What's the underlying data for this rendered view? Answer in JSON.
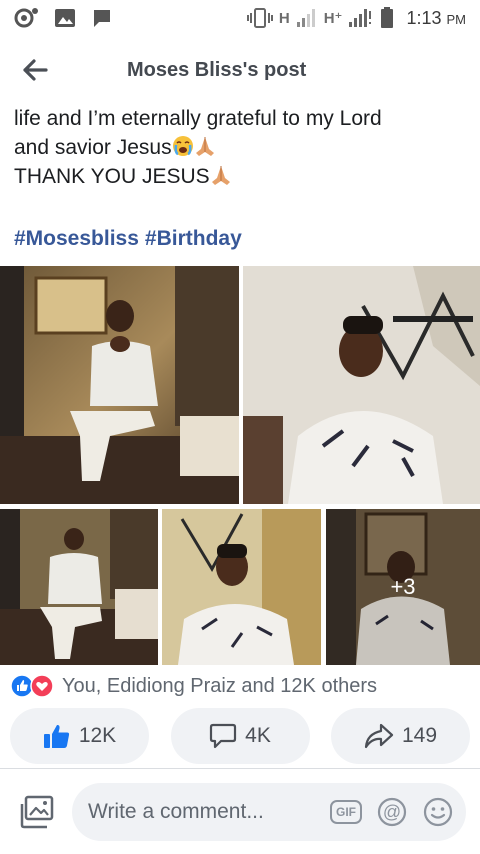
{
  "status_bar": {
    "icons": [
      "notification-dot-icon",
      "image-icon",
      "chat-icon"
    ],
    "network_1": "H",
    "network_2": "H⁺",
    "time": "1:13",
    "time_suffix": "PM"
  },
  "header": {
    "title": "Moses Bliss's post"
  },
  "post": {
    "line_1": "life and I’m eternally grateful to my Lord",
    "line_2": "and savior Jesus",
    "line_3": "THANK YOU JESUS",
    "hashtags": [
      "#Mosesbliss",
      "#Birthday"
    ]
  },
  "photos": {
    "more_count": "+3"
  },
  "reactions": {
    "summary": "You, Edidiong Praiz and 12K others"
  },
  "actions": {
    "like_count": "12K",
    "comment_count": "4K",
    "share_count": "149"
  },
  "comment_bar": {
    "placeholder": "Write a comment...",
    "gif_label": "GIF"
  },
  "colors": {
    "link": "#385898",
    "like_blue": "#1877f2",
    "love_red": "#f33e58",
    "button_bg": "#f0f2f5"
  }
}
